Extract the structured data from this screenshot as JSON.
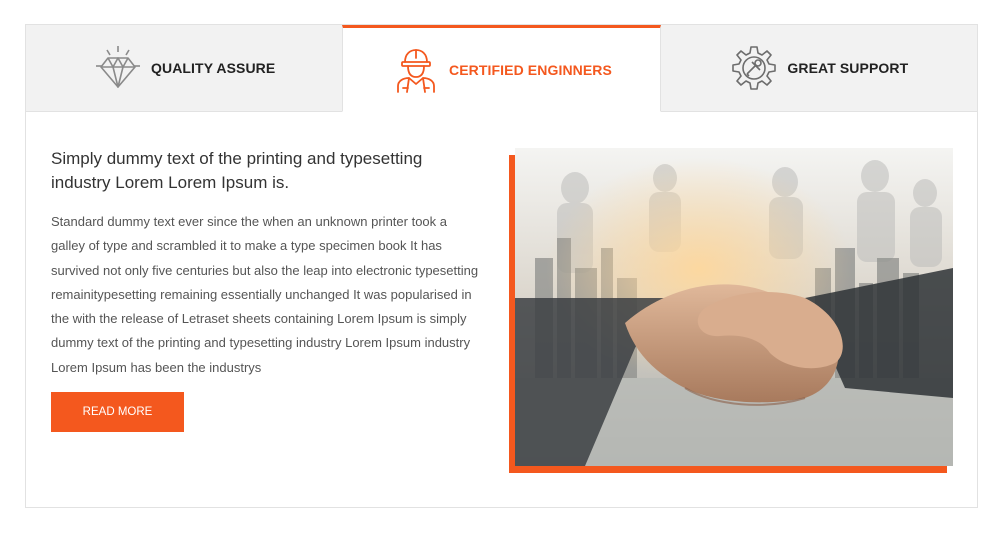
{
  "tabs": [
    {
      "label": "QUALITY ASSURE",
      "icon": "diamond-icon",
      "active": false
    },
    {
      "label": "CERTIFIED ENGINNERS",
      "icon": "engineer-icon",
      "active": true
    },
    {
      "label": "GREAT SUPPORT",
      "icon": "gear-wrench-icon",
      "active": false
    }
  ],
  "content": {
    "heading": "Simply dummy text of the printing and typesetting industry Lorem Lorem Ipsum is.",
    "body": "Standard dummy text ever since the when an unknown printer took a galley of type and scrambled it to make a type specimen book It has survived not only five centuries but also the leap into electronic typesetting remainitypesetting remaining essentially unchanged It was popularised in the with the release of Letraset sheets containing Lorem Ipsum is simply dummy text of the printing and typesetting industry Lorem Ipsum industry Lorem Ipsum has been the industrys",
    "button_label": "READ MORE",
    "image": "handshake-photo"
  },
  "colors": {
    "accent": "#f4581e",
    "tab_bg": "#f2f2f2",
    "text": "#333333"
  }
}
